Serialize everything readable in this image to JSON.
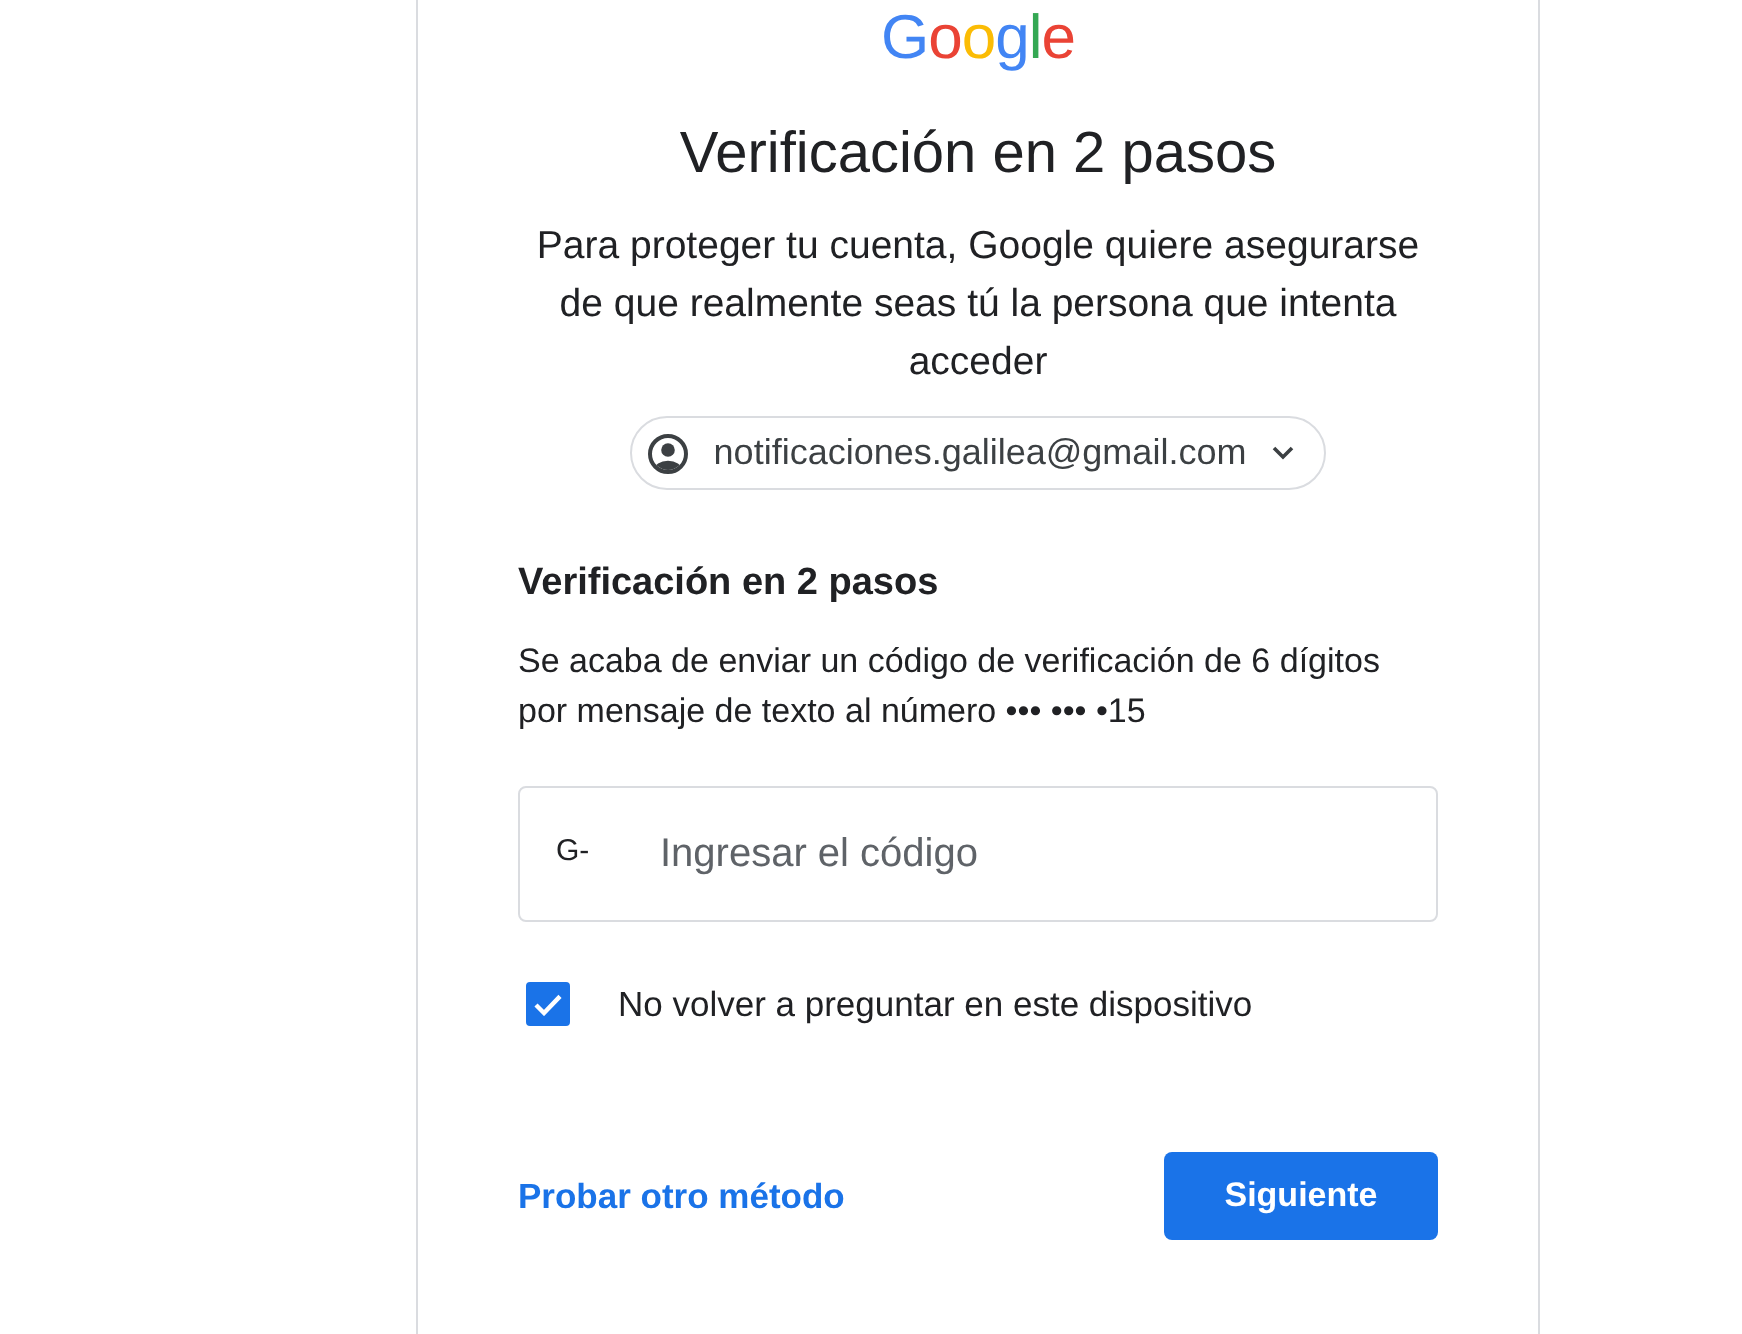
{
  "logo": {
    "text": "Google"
  },
  "title": "Verificación en 2 pasos",
  "description": "Para proteger tu cuenta, Google quiere asegurarse de que realmente seas tú la persona que intenta acceder",
  "account": {
    "email": "notificaciones.galilea@gmail.com"
  },
  "section": {
    "heading": "Verificación en 2 pasos",
    "message": "Se acaba de enviar un código de verificación de 6 dígitos por mensaje de texto al número ••• ••• •15"
  },
  "code_field": {
    "prefix": "G-",
    "placeholder": "Ingresar el código"
  },
  "remember": {
    "label": "No volver a preguntar en este dispositivo",
    "checked": true
  },
  "footer": {
    "link": "Probar otro método",
    "button": "Siguiente"
  }
}
